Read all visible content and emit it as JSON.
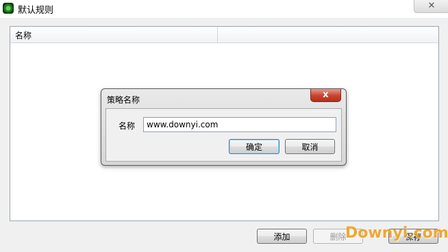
{
  "window": {
    "title": "默认规则",
    "close_glyph": "✕"
  },
  "list": {
    "columns": [
      "名称",
      ""
    ]
  },
  "buttons": {
    "add": "添加",
    "delete": "删除",
    "save": "保存"
  },
  "dialog": {
    "title": "策略名称",
    "close_glyph": "x",
    "name_label": "名称",
    "name_value": "www.downyi.com",
    "ok": "确定",
    "cancel": "取消"
  },
  "watermark": "Downyi.com",
  "icons": {
    "app": "app-icon",
    "window_close": "close-icon",
    "dialog_close": "close-icon"
  }
}
